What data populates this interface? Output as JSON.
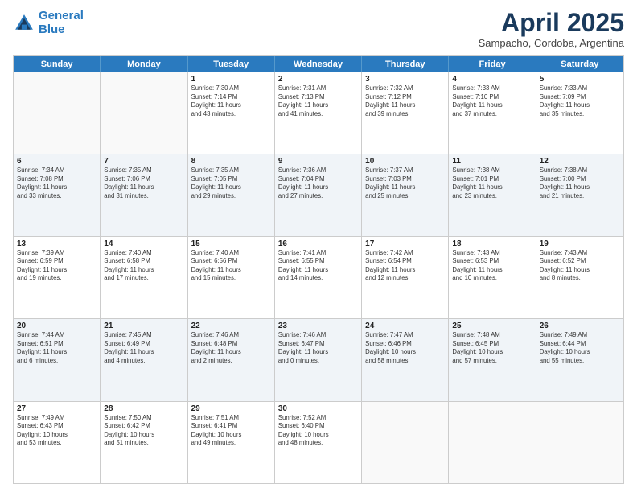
{
  "logo": {
    "line1": "General",
    "line2": "Blue"
  },
  "title": {
    "month_year": "April 2025",
    "location": "Sampacho, Cordoba, Argentina"
  },
  "weekdays": [
    "Sunday",
    "Monday",
    "Tuesday",
    "Wednesday",
    "Thursday",
    "Friday",
    "Saturday"
  ],
  "rows": [
    [
      {
        "day": "",
        "info": ""
      },
      {
        "day": "",
        "info": ""
      },
      {
        "day": "1",
        "info": "Sunrise: 7:30 AM\nSunset: 7:14 PM\nDaylight: 11 hours\nand 43 minutes."
      },
      {
        "day": "2",
        "info": "Sunrise: 7:31 AM\nSunset: 7:13 PM\nDaylight: 11 hours\nand 41 minutes."
      },
      {
        "day": "3",
        "info": "Sunrise: 7:32 AM\nSunset: 7:12 PM\nDaylight: 11 hours\nand 39 minutes."
      },
      {
        "day": "4",
        "info": "Sunrise: 7:33 AM\nSunset: 7:10 PM\nDaylight: 11 hours\nand 37 minutes."
      },
      {
        "day": "5",
        "info": "Sunrise: 7:33 AM\nSunset: 7:09 PM\nDaylight: 11 hours\nand 35 minutes."
      }
    ],
    [
      {
        "day": "6",
        "info": "Sunrise: 7:34 AM\nSunset: 7:08 PM\nDaylight: 11 hours\nand 33 minutes."
      },
      {
        "day": "7",
        "info": "Sunrise: 7:35 AM\nSunset: 7:06 PM\nDaylight: 11 hours\nand 31 minutes."
      },
      {
        "day": "8",
        "info": "Sunrise: 7:35 AM\nSunset: 7:05 PM\nDaylight: 11 hours\nand 29 minutes."
      },
      {
        "day": "9",
        "info": "Sunrise: 7:36 AM\nSunset: 7:04 PM\nDaylight: 11 hours\nand 27 minutes."
      },
      {
        "day": "10",
        "info": "Sunrise: 7:37 AM\nSunset: 7:03 PM\nDaylight: 11 hours\nand 25 minutes."
      },
      {
        "day": "11",
        "info": "Sunrise: 7:38 AM\nSunset: 7:01 PM\nDaylight: 11 hours\nand 23 minutes."
      },
      {
        "day": "12",
        "info": "Sunrise: 7:38 AM\nSunset: 7:00 PM\nDaylight: 11 hours\nand 21 minutes."
      }
    ],
    [
      {
        "day": "13",
        "info": "Sunrise: 7:39 AM\nSunset: 6:59 PM\nDaylight: 11 hours\nand 19 minutes."
      },
      {
        "day": "14",
        "info": "Sunrise: 7:40 AM\nSunset: 6:58 PM\nDaylight: 11 hours\nand 17 minutes."
      },
      {
        "day": "15",
        "info": "Sunrise: 7:40 AM\nSunset: 6:56 PM\nDaylight: 11 hours\nand 15 minutes."
      },
      {
        "day": "16",
        "info": "Sunrise: 7:41 AM\nSunset: 6:55 PM\nDaylight: 11 hours\nand 14 minutes."
      },
      {
        "day": "17",
        "info": "Sunrise: 7:42 AM\nSunset: 6:54 PM\nDaylight: 11 hours\nand 12 minutes."
      },
      {
        "day": "18",
        "info": "Sunrise: 7:43 AM\nSunset: 6:53 PM\nDaylight: 11 hours\nand 10 minutes."
      },
      {
        "day": "19",
        "info": "Sunrise: 7:43 AM\nSunset: 6:52 PM\nDaylight: 11 hours\nand 8 minutes."
      }
    ],
    [
      {
        "day": "20",
        "info": "Sunrise: 7:44 AM\nSunset: 6:51 PM\nDaylight: 11 hours\nand 6 minutes."
      },
      {
        "day": "21",
        "info": "Sunrise: 7:45 AM\nSunset: 6:49 PM\nDaylight: 11 hours\nand 4 minutes."
      },
      {
        "day": "22",
        "info": "Sunrise: 7:46 AM\nSunset: 6:48 PM\nDaylight: 11 hours\nand 2 minutes."
      },
      {
        "day": "23",
        "info": "Sunrise: 7:46 AM\nSunset: 6:47 PM\nDaylight: 11 hours\nand 0 minutes."
      },
      {
        "day": "24",
        "info": "Sunrise: 7:47 AM\nSunset: 6:46 PM\nDaylight: 10 hours\nand 58 minutes."
      },
      {
        "day": "25",
        "info": "Sunrise: 7:48 AM\nSunset: 6:45 PM\nDaylight: 10 hours\nand 57 minutes."
      },
      {
        "day": "26",
        "info": "Sunrise: 7:49 AM\nSunset: 6:44 PM\nDaylight: 10 hours\nand 55 minutes."
      }
    ],
    [
      {
        "day": "27",
        "info": "Sunrise: 7:49 AM\nSunset: 6:43 PM\nDaylight: 10 hours\nand 53 minutes."
      },
      {
        "day": "28",
        "info": "Sunrise: 7:50 AM\nSunset: 6:42 PM\nDaylight: 10 hours\nand 51 minutes."
      },
      {
        "day": "29",
        "info": "Sunrise: 7:51 AM\nSunset: 6:41 PM\nDaylight: 10 hours\nand 49 minutes."
      },
      {
        "day": "30",
        "info": "Sunrise: 7:52 AM\nSunset: 6:40 PM\nDaylight: 10 hours\nand 48 minutes."
      },
      {
        "day": "",
        "info": ""
      },
      {
        "day": "",
        "info": ""
      },
      {
        "day": "",
        "info": ""
      }
    ]
  ]
}
